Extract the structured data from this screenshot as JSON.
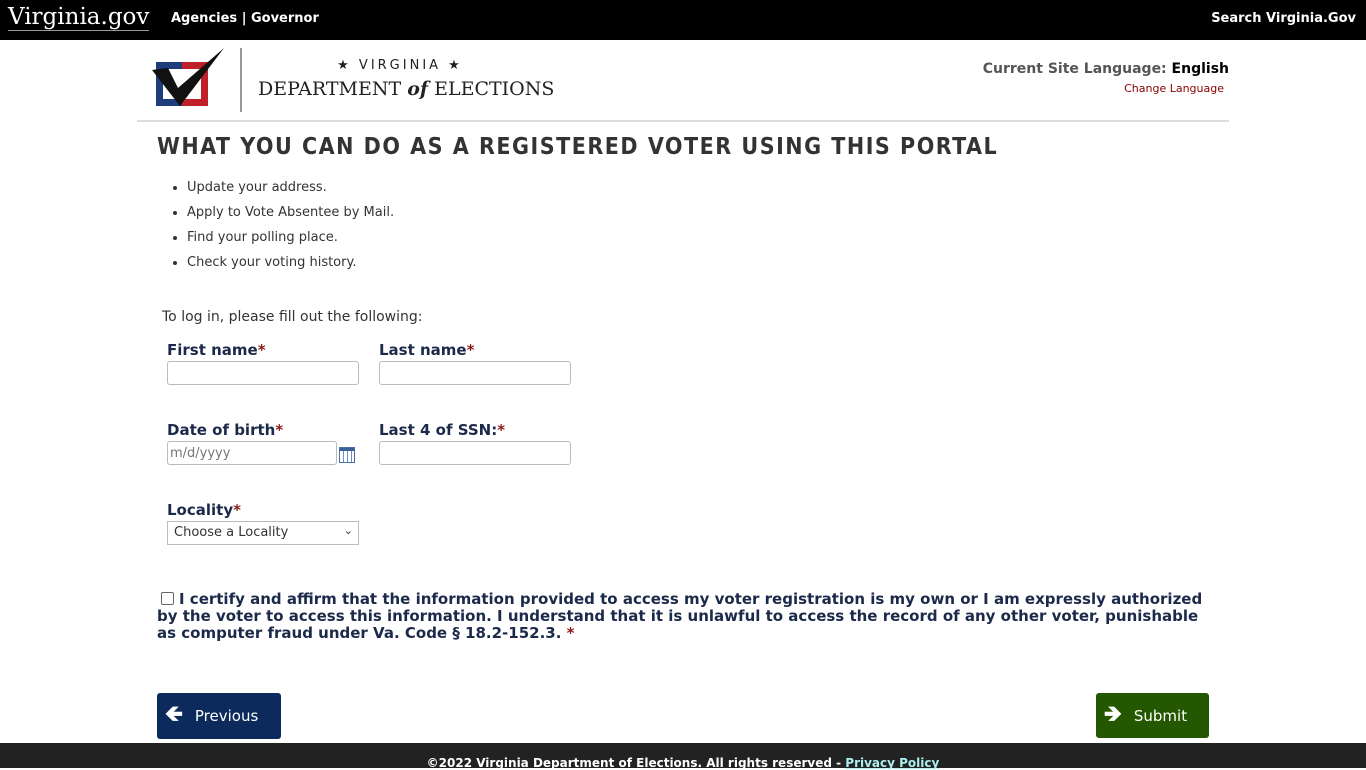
{
  "topbar": {
    "brand": "Virginia.gov",
    "agencies": "Agencies",
    "sep": "|",
    "governor": "Governor",
    "search": "Search Virginia.Gov"
  },
  "logo": {
    "line1": "★ VIRGINIA ★",
    "line2a": "DEPARTMENT",
    "line2b": "of",
    "line2c": "ELECTIONS"
  },
  "language": {
    "label": "Current Site Language:",
    "value": "English",
    "change": "Change Language"
  },
  "page_title": "WHAT YOU CAN DO AS A REGISTERED VOTER USING THIS PORTAL",
  "features": [
    "Update your address.",
    "Apply to Vote Absentee by Mail.",
    "Find your polling place.",
    "Check your voting history."
  ],
  "form": {
    "intro": "To log in, please fill out the following:",
    "required_mark": "*",
    "first_name": {
      "label": "First name",
      "value": ""
    },
    "last_name": {
      "label": "Last name",
      "value": ""
    },
    "dob": {
      "label": "Date of birth",
      "placeholder": "m/d/yyyy"
    },
    "ssn": {
      "label": "Last 4 of SSN:",
      "value": ""
    },
    "locality": {
      "label": "Locality",
      "selected": "Choose a Locality"
    },
    "certify": "I certify and affirm that the information provided to access my voter registration is my own or I am expressly authorized by the voter to access this information. I understand that it is unlawful to access the record of any other voter, punishable as computer fraud under Va. Code § 18.2-152.3."
  },
  "buttons": {
    "previous": "Previous",
    "submit": "Submit"
  },
  "footer": {
    "copyright": "©2022 Virginia Department of Elections. All rights reserved - ",
    "privacy": "Privacy Policy"
  },
  "colors": {
    "previous_bg": "#0d2a5c",
    "submit_bg": "#245800",
    "label": "#1b2a4a",
    "required": "#8b1a1a"
  }
}
